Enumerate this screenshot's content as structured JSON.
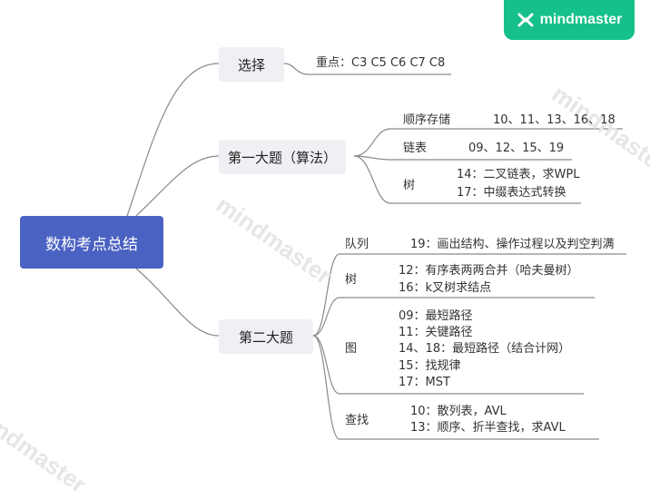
{
  "brand": {
    "name": "mindmaster"
  },
  "watermark": {
    "text": "mindmaster"
  },
  "root": {
    "label": "数构考点总结"
  },
  "branch1": {
    "label": "选择",
    "topic": "重点：C3 C5 C6 C7 C8"
  },
  "branch2": {
    "label": "第一大题（算法）",
    "children": [
      {
        "label": "顺序存储",
        "items": [
          "10、11、13、16、18"
        ]
      },
      {
        "label": "链表",
        "items": [
          "09、12、15、19"
        ]
      },
      {
        "label": "树",
        "items": [
          "14：二叉链表，求WPL",
          "17：中缀表达式转换"
        ]
      }
    ]
  },
  "branch3": {
    "label": "第二大题",
    "children": [
      {
        "label": "队列",
        "items": [
          "19：画出结构、操作过程以及判空判满"
        ]
      },
      {
        "label": "树",
        "items": [
          "12：有序表两两合并（哈夫曼树）",
          "16：k叉树求结点"
        ]
      },
      {
        "label": "图",
        "items": [
          "09：最短路径",
          "11：关键路径",
          "14、18：最短路径（结合计网）",
          "15：找规律",
          "17：MST"
        ]
      },
      {
        "label": "查找",
        "items": [
          "10：散列表，AVL",
          "13：顺序、折半查找，求AVL"
        ]
      }
    ]
  },
  "colors": {
    "root": "#4a62c2",
    "branch_bg": "#eef0f4",
    "line": "#888888",
    "brand": "#16c08a"
  }
}
